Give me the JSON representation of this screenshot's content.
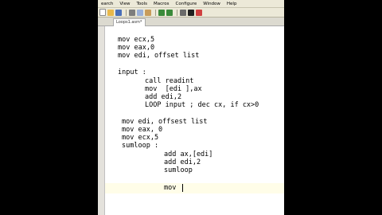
{
  "menubar": {
    "items": [
      "earch",
      "View",
      "Tools",
      "Macros",
      "Configure",
      "Window",
      "Help"
    ]
  },
  "toolbar": {
    "icons": [
      {
        "name": "new-file-icon",
        "color": "#ffffff"
      },
      {
        "name": "open-folder-icon",
        "color": "#e8b84a"
      },
      {
        "name": "save-icon",
        "color": "#4a6fb8"
      },
      {
        "name": "cut-icon",
        "color": "#7d7d7d"
      },
      {
        "name": "copy-icon",
        "color": "#9ab0d8"
      },
      {
        "name": "paste-icon",
        "color": "#c89c5a"
      },
      {
        "name": "undo-icon",
        "color": "#3a8a3a"
      },
      {
        "name": "redo-icon",
        "color": "#3a8a3a"
      },
      {
        "name": "find-icon",
        "color": "#6a6a6a"
      },
      {
        "name": "bold-icon",
        "color": "#202020"
      },
      {
        "name": "run-icon",
        "color": "#d04040"
      }
    ]
  },
  "tab": {
    "label": "Loops1.asm*"
  },
  "editor": {
    "lines": [
      "mov ecx,5",
      "mov eax,0",
      "mov edi, offset list",
      "input :",
      "call readint",
      "mov  [edi ],ax",
      "add edi,2",
      "LOOP input ; dec cx, if cx>0",
      "mov edi, offsest list",
      "mov eax, 0",
      "mov ecx,5",
      "sumloop :",
      "add ax,[edi]",
      "add edi,2",
      "sumloop",
      "mov "
    ]
  },
  "colors": {
    "background": "#000000",
    "editor_background": "#ffffff",
    "current_line": "#fffde8"
  }
}
